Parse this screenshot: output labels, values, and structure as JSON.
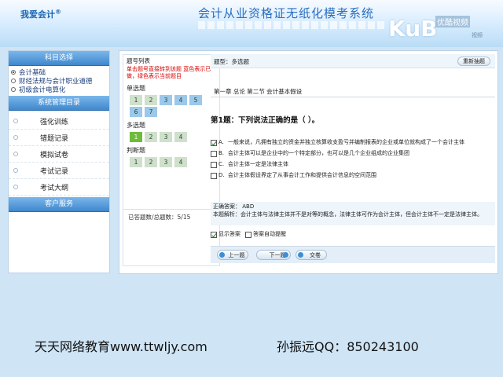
{
  "header": {
    "logo": "我爱会计",
    "title": "会计从业资格证无纸化模考系统",
    "watermark": "KuB",
    "watermark_cn": "优酷视频",
    "watermark_small": "视频"
  },
  "sidebar": {
    "subject_head": "科目选择",
    "subjects": [
      {
        "label": "会计基础",
        "selected": true
      },
      {
        "label": "财经法规与会计职业道德",
        "selected": false
      },
      {
        "label": "初级会计电算化",
        "selected": false
      }
    ],
    "mgmt_head": "系统管理目录",
    "menu": [
      "强化训练",
      "错题记录",
      "模拟试卷",
      "考试记录",
      "考试大纲"
    ],
    "service_head": "客户服务"
  },
  "question_list": {
    "title": "题号列表",
    "note": "单击题号直接转到该题 蓝色表示已做，绿色表示当前题目",
    "sections": [
      {
        "label": "单选题",
        "nums": [
          "1",
          "2",
          "3",
          "4",
          "5",
          "6",
          "7"
        ],
        "blue": [
          2,
          4,
          5,
          6,
          7
        ]
      },
      {
        "label": "多选题",
        "nums": [
          "1",
          "2",
          "3",
          "4"
        ],
        "green": [
          1
        ]
      },
      {
        "label": "判断题",
        "nums": [
          "1",
          "2",
          "3",
          "4"
        ]
      }
    ],
    "status": "已答题数/总题数：5/15"
  },
  "question": {
    "type": "题型：多选题",
    "redraw": "重新抽题",
    "chapter": "第一章 总论    第二节 会计基本假设",
    "text": "第1题：下列说法正确的是（ ）。",
    "options": [
      {
        "letter": "A.",
        "text": "一般来说，凡拥有独立的资金并独立核算收支盈亏并编制报表的企业或单位就构成了一个会计主体",
        "checked": true
      },
      {
        "letter": "B.",
        "text": "会计主体可以是企业中的一个特定部分，也可以是几个企业组成的企业集团",
        "checked": false
      },
      {
        "letter": "C.",
        "text": "会计主体一定是法律主体",
        "checked": false
      },
      {
        "letter": "D.",
        "text": "会计主体假设界定了从事会计工作和提供会计信息的空间范围",
        "checked": false
      }
    ],
    "answer_label": "正确答案：  ABD",
    "explain": "本题解析：会计主体与法律主体并不是对等的概念，法律主体可作为会计主体，但会计主体不一定是法律主体。",
    "show_answer": "显示答案",
    "auto_answer": "答案自动提醒",
    "prev": "上一题",
    "next": "下一题",
    "submit": "交卷"
  },
  "footer": {
    "left": "天天网络教育www.ttwljy.com",
    "right": "孙振远QQ：850243100"
  }
}
